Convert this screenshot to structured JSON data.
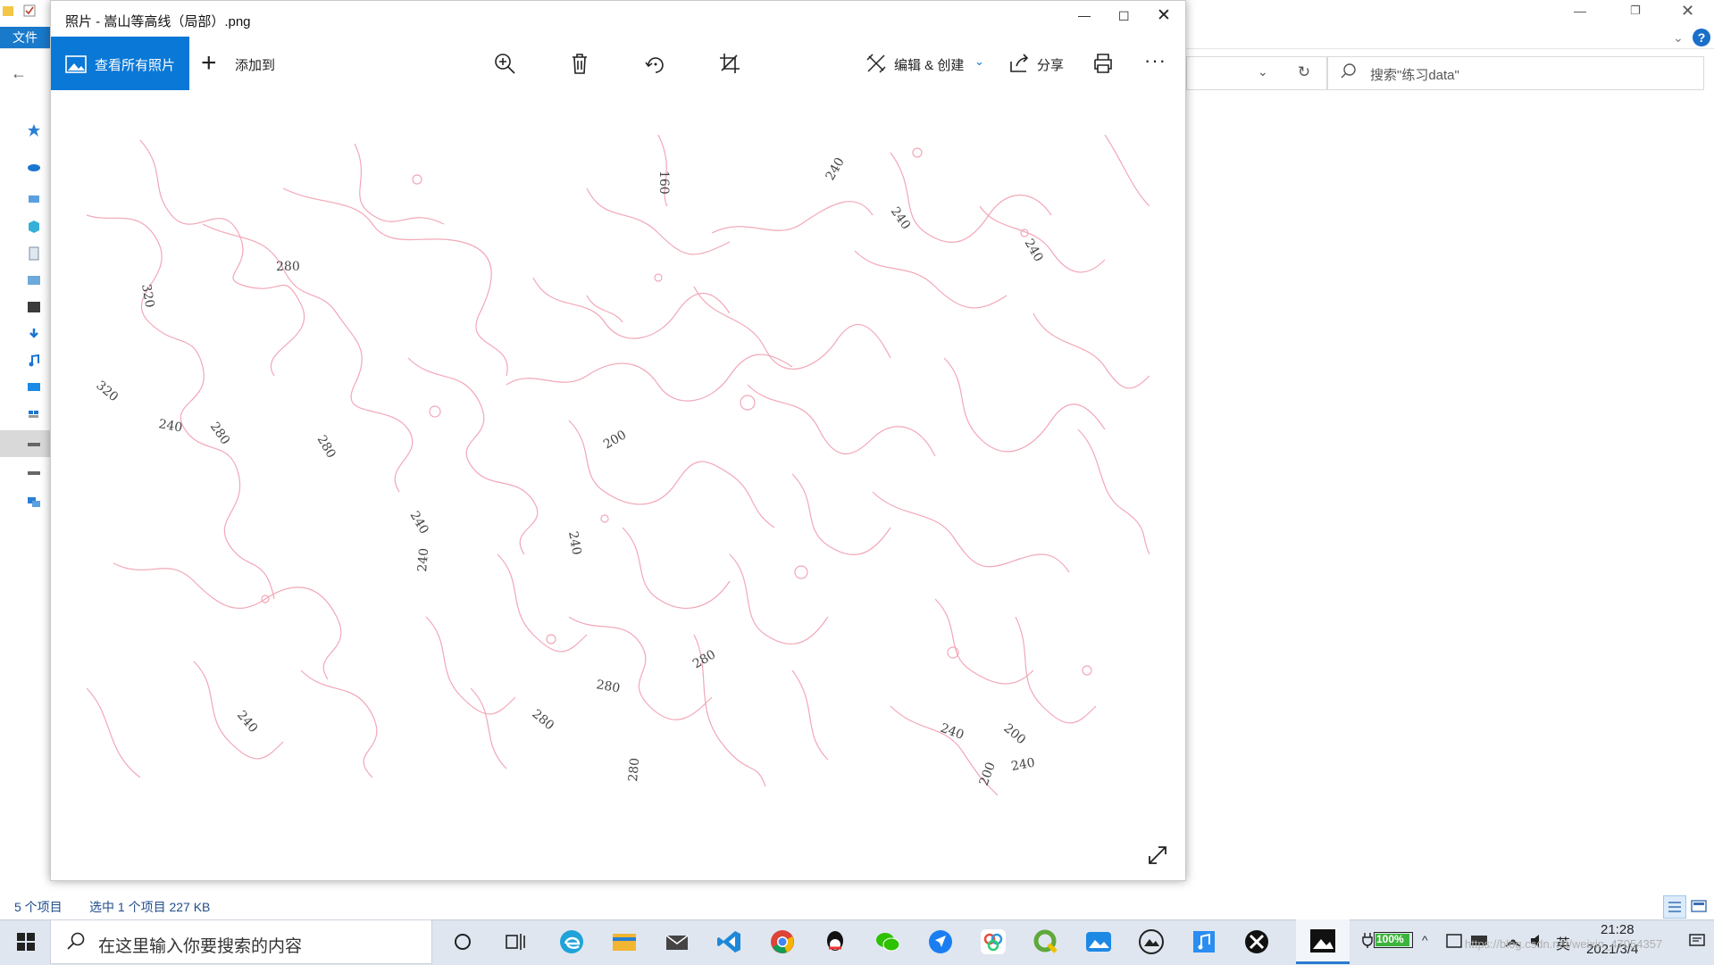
{
  "explorer": {
    "ribbon_tab": "文件",
    "search_placeholder": "搜索\"练习data\"",
    "status_count": "5 个项目",
    "status_selection": "选中 1 个项目  227 KB"
  },
  "photos": {
    "title": "照片 - 嵩山等高线（局部）.png",
    "view_all_label": "查看所有照片",
    "add_to_label": "添加到",
    "edit_create_label": "编辑 & 创建",
    "share_label": "分享",
    "contour_labels": [
      "160",
      "240",
      "240",
      "240",
      "280",
      "320",
      "320",
      "240",
      "280",
      "280",
      "200",
      "240",
      "240",
      "240",
      "280",
      "280",
      "280",
      "280",
      "240",
      "240",
      "200",
      "200",
      "240"
    ]
  },
  "taskbar": {
    "search_placeholder": "在这里输入你要搜索的内容",
    "battery": "100%",
    "ime": "英",
    "time": "21:28",
    "date": "2021/3/4",
    "watermark": "https://blog.csdn.net/weixin_47054357"
  },
  "colors": {
    "accent": "#0a78d7",
    "contour": "#f2a7b7",
    "taskbar": "#dfe6f0"
  }
}
